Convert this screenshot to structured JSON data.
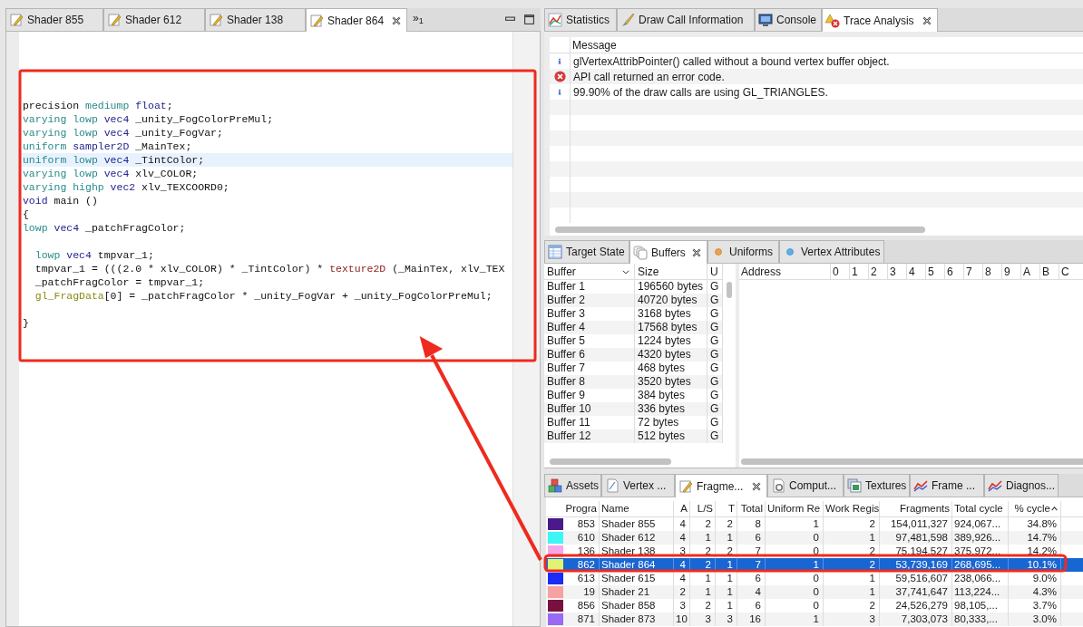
{
  "editor": {
    "tabs": [
      {
        "label": "Shader 855",
        "selected": false
      },
      {
        "label": "Shader 612",
        "selected": false
      },
      {
        "label": "Shader 138",
        "selected": false
      },
      {
        "label": "Shader 864",
        "selected": true
      }
    ],
    "overflow": "»$_{1}$",
    "code": [
      {
        "kind": "code",
        "highlighted": false,
        "tokens": [
          {
            "text": "precision",
            "kind": "plain"
          },
          {
            "text": " mediump",
            "kind": "qual"
          },
          {
            "text": " float",
            "kind": "type"
          },
          {
            "text": ";",
            "kind": "plain"
          }
        ]
      },
      {
        "kind": "code",
        "highlighted": false,
        "tokens": [
          {
            "text": "varying lowp",
            "kind": "qual"
          },
          {
            "text": " vec4",
            "kind": "type"
          },
          {
            "text": " _unity_FogColorPreMul;",
            "kind": "plain"
          }
        ]
      },
      {
        "kind": "code",
        "highlighted": false,
        "tokens": [
          {
            "text": "varying lowp",
            "kind": "qual"
          },
          {
            "text": " vec4",
            "kind": "type"
          },
          {
            "text": " _unity_FogVar;",
            "kind": "plain"
          }
        ]
      },
      {
        "kind": "code",
        "highlighted": false,
        "tokens": [
          {
            "text": "uniform",
            "kind": "qual"
          },
          {
            "text": " sampler2D",
            "kind": "type"
          },
          {
            "text": " _MainTex;",
            "kind": "plain"
          }
        ]
      },
      {
        "kind": "code",
        "highlighted": true,
        "tokens": [
          {
            "text": "uniform lowp",
            "kind": "qual"
          },
          {
            "text": " vec4",
            "kind": "type"
          },
          {
            "text": " _TintColor;",
            "kind": "plain"
          }
        ]
      },
      {
        "kind": "code",
        "highlighted": false,
        "tokens": [
          {
            "text": "varying lowp",
            "kind": "qual"
          },
          {
            "text": " vec4",
            "kind": "type"
          },
          {
            "text": " xlv_COLOR;",
            "kind": "plain"
          }
        ]
      },
      {
        "kind": "code",
        "highlighted": false,
        "tokens": [
          {
            "text": "varying highp",
            "kind": "qual"
          },
          {
            "text": " vec2",
            "kind": "type"
          },
          {
            "text": " xlv_TEXCOORD0;",
            "kind": "plain"
          }
        ]
      },
      {
        "kind": "code",
        "highlighted": false,
        "tokens": [
          {
            "text": "void",
            "kind": "type"
          },
          {
            "text": " main ()",
            "kind": "plain"
          }
        ]
      },
      {
        "kind": "code",
        "highlighted": false,
        "tokens": [
          {
            "text": "{",
            "kind": "plain"
          }
        ]
      },
      {
        "kind": "code",
        "highlighted": false,
        "tokens": [
          {
            "text": "lowp",
            "kind": "qual"
          },
          {
            "text": " vec4",
            "kind": "type"
          },
          {
            "text": " _patchFragColor;",
            "kind": "plain"
          }
        ]
      },
      {
        "kind": "blank",
        "highlighted": false
      },
      {
        "kind": "code",
        "highlighted": false,
        "tokens": [
          {
            "text": "  lowp",
            "kind": "qual"
          },
          {
            "text": " vec4",
            "kind": "type"
          },
          {
            "text": " tmpvar_1;",
            "kind": "plain"
          }
        ]
      },
      {
        "kind": "code",
        "highlighted": false,
        "tokens": [
          {
            "text": "  tmpvar_1 = (((2.0 * xlv_COLOR) * _TintColor) *",
            "kind": "plain"
          },
          {
            "text": " texture2D",
            "kind": "builtin"
          },
          {
            "text": " (_MainTex, xlv_TEX",
            "kind": "plain"
          }
        ]
      },
      {
        "kind": "code",
        "highlighted": false,
        "tokens": [
          {
            "text": "  _patchFragColor = tmpvar_1;",
            "kind": "plain"
          }
        ]
      },
      {
        "kind": "code",
        "highlighted": false,
        "tokens": [
          {
            "text": "  gl_FragData",
            "kind": "glvar"
          },
          {
            "text": "[0] = _patchFragColor * _unity_FogVar + _unity_FogColorPreMul;",
            "kind": "plain"
          }
        ]
      },
      {
        "kind": "blank",
        "highlighted": false
      },
      {
        "kind": "code",
        "highlighted": false,
        "tokens": [
          {
            "text": "}",
            "kind": "plain"
          }
        ]
      }
    ]
  },
  "trace_panel": {
    "tabs": [
      {
        "label": "Statistics",
        "selected": false
      },
      {
        "label": "Draw Call Information",
        "selected": false
      },
      {
        "label": "Console",
        "selected": false
      },
      {
        "label": "Trace Analysis",
        "selected": true
      }
    ],
    "column": "Message",
    "messages": [
      {
        "kind": "info",
        "text": "glVertexAttribPointer() called without a bound vertex buffer object."
      },
      {
        "kind": "error",
        "text": "API call returned an error code."
      },
      {
        "kind": "info",
        "text": "99.90% of the draw calls are using GL_TRIANGLES."
      }
    ]
  },
  "buffers_panel": {
    "tabs": [
      {
        "label": "Target State",
        "selected": false
      },
      {
        "label": "Buffers",
        "selected": true
      },
      {
        "label": "Uniforms",
        "selected": false
      },
      {
        "label": "Vertex Attributes",
        "selected": false
      }
    ],
    "columns": [
      "Buffer",
      "Size",
      "U"
    ],
    "rows": [
      [
        "Buffer 1",
        "196560 bytes",
        "G"
      ],
      [
        "Buffer 2",
        "40720 bytes",
        "G"
      ],
      [
        "Buffer 3",
        "3168 bytes",
        "G"
      ],
      [
        "Buffer 4",
        "17568 bytes",
        "G"
      ],
      [
        "Buffer 5",
        "1224 bytes",
        "G"
      ],
      [
        "Buffer 6",
        "4320 bytes",
        "G"
      ],
      [
        "Buffer 7",
        "468 bytes",
        "G"
      ],
      [
        "Buffer 8",
        "3520 bytes",
        "G"
      ],
      [
        "Buffer 9",
        "384 bytes",
        "G"
      ],
      [
        "Buffer 10",
        "336 bytes",
        "G"
      ],
      [
        "Buffer 11",
        "72 bytes",
        "G"
      ],
      [
        "Buffer 12",
        "512 bytes",
        "G"
      ]
    ],
    "address_columns": [
      "Address",
      "0",
      "1",
      "2",
      "3",
      "4",
      "5",
      "6",
      "7",
      "8",
      "9",
      "A",
      "B",
      "C"
    ]
  },
  "shaders_panel": {
    "tabs": [
      {
        "label": "Assets",
        "selected": false
      },
      {
        "label": "Vertex ...",
        "selected": false
      },
      {
        "label": "Fragme...",
        "selected": true
      },
      {
        "label": "Comput...",
        "selected": false
      },
      {
        "label": "Textures",
        "selected": false
      },
      {
        "label": "Frame ...",
        "selected": false
      },
      {
        "label": "Diagnos...",
        "selected": false
      }
    ],
    "columns": [
      "Progra",
      "Name",
      "A",
      "L/S",
      "T",
      "Total",
      "Uniform Re",
      "Work Regis",
      "Fragments",
      "Total cycle",
      "% cycle"
    ],
    "rows": [
      {
        "color": "#4a1a8c",
        "selected": false,
        "cells": [
          "853",
          "Shader 855",
          "4",
          "2",
          "2",
          "8",
          "1",
          "2",
          "154,011,327",
          "924,067...",
          "34.8%"
        ]
      },
      {
        "color": "#3ff6f6",
        "selected": false,
        "cells": [
          "610",
          "Shader 612",
          "4",
          "1",
          "1",
          "6",
          "0",
          "1",
          "97,481,598",
          "389,926...",
          "14.7%"
        ]
      },
      {
        "color": "#f6a6ea",
        "selected": false,
        "cells": [
          "136",
          "Shader 138",
          "3",
          "2",
          "2",
          "7",
          "0",
          "2",
          "75,194,527",
          "375,972...",
          "14.2%"
        ]
      },
      {
        "color": "#e2f272",
        "selected": true,
        "cells": [
          "862",
          "Shader 864",
          "4",
          "2",
          "1",
          "7",
          "1",
          "2",
          "53,739,169",
          "268,695...",
          "10.1%"
        ]
      },
      {
        "color": "#1a2cf6",
        "selected": false,
        "cells": [
          "613",
          "Shader 615",
          "4",
          "1",
          "1",
          "6",
          "0",
          "1",
          "59,516,607",
          "238,066...",
          "9.0%"
        ]
      },
      {
        "color": "#f6a2a2",
        "selected": false,
        "cells": [
          "19",
          "Shader 21",
          "2",
          "1",
          "1",
          "4",
          "0",
          "1",
          "37,741,647",
          "113,224...",
          "4.3%"
        ]
      },
      {
        "color": "#7a1040",
        "selected": false,
        "cells": [
          "856",
          "Shader 858",
          "3",
          "2",
          "1",
          "6",
          "0",
          "2",
          "24,526,279",
          "98,105,...",
          "3.7%"
        ]
      },
      {
        "color": "#9a6af6",
        "selected": false,
        "cells": [
          "871",
          "Shader 873",
          "10",
          "3",
          "3",
          "16",
          "1",
          "3",
          "7,303,073",
          "80,333,...",
          "3.0%"
        ]
      }
    ]
  }
}
